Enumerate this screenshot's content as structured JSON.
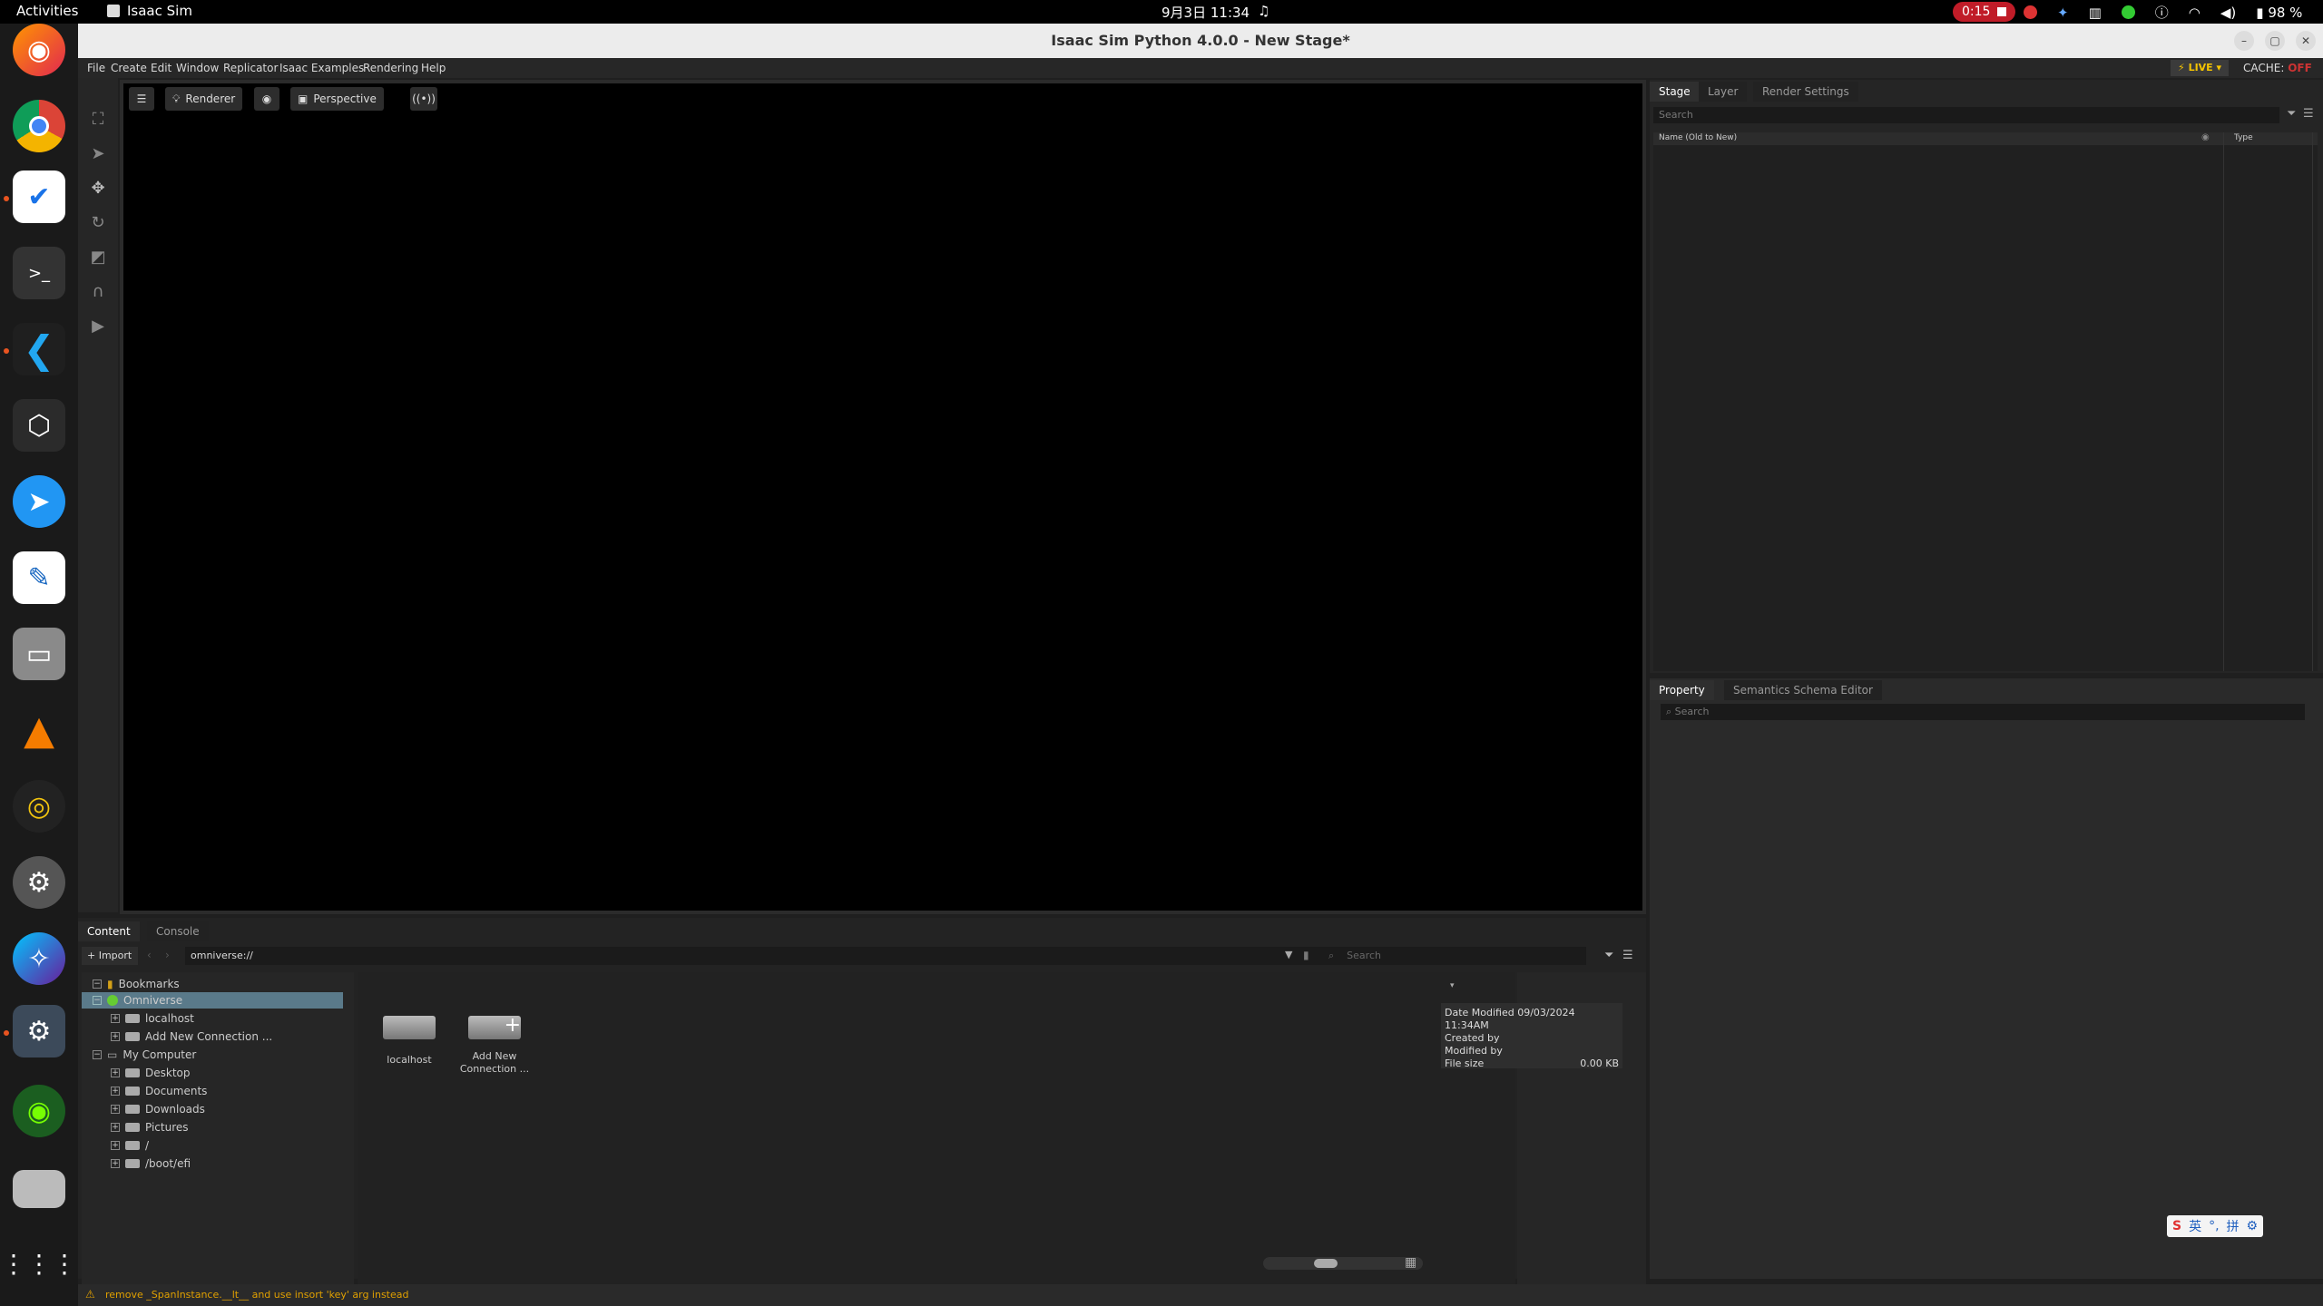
{
  "topbar": {
    "activities": "Activities",
    "app_name": "Isaac Sim",
    "clock": "9月3日 11:34",
    "recording": "0:15",
    "battery": "98 %"
  },
  "window": {
    "title": "Isaac Sim Python 4.0.0 - New Stage*"
  },
  "menu": {
    "items": [
      "File",
      "Create",
      "Edit",
      "Window",
      "Replicator",
      "Isaac Examples",
      "Rendering",
      "Help"
    ],
    "live": "LIVE",
    "cache_label": "CACHE:",
    "cache_value": "OFF"
  },
  "viewport": {
    "renderer_label": "Renderer",
    "camera_label": "Perspective"
  },
  "stage": {
    "tabs": [
      "Stage",
      "Layer",
      "Render Settings"
    ],
    "search_placeholder": "Search",
    "col_name": "Name (Old to New)",
    "col_type": "Type"
  },
  "property": {
    "tabs": [
      "Property",
      "Semantics Schema Editor"
    ],
    "search_placeholder": "Search"
  },
  "content": {
    "tabs": [
      "Content",
      "Console"
    ],
    "import_label": "Import",
    "path": "omniverse://",
    "search_placeholder": "Search",
    "tree": {
      "bookmarks": "Bookmarks",
      "omniverse": "Omniverse",
      "localhost": "localhost",
      "add_connection": "Add New Connection ...",
      "my_computer": "My Computer",
      "desktop": "Desktop",
      "documents": "Documents",
      "downloads": "Downloads",
      "pictures": "Pictures",
      "root": "/",
      "boot": "/boot/efi"
    },
    "grid": {
      "localhost": "localhost",
      "add_line1": "Add New",
      "add_line2": "Connection ..."
    },
    "details": {
      "date_modified": "Date Modified 09/03/2024 11:34AM",
      "created_by": "Created by",
      "modified_by": "Modified by",
      "file_size_label": "File size",
      "file_size_value": "0.00 KB"
    }
  },
  "status": {
    "message": "remove _SpanInstance.__lt__ and use insort 'key' arg instead"
  },
  "ime": {
    "lang": "英",
    "mode": "拼"
  }
}
